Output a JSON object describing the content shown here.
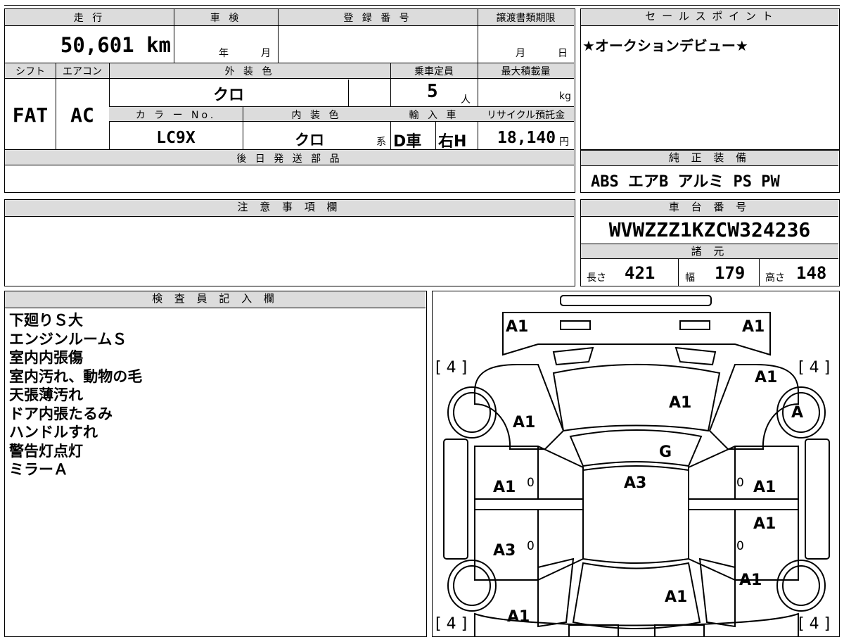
{
  "top_table": {
    "mileage_label": "走 行",
    "mileage_value": "50,601 km",
    "inspection_label": "車 検",
    "inspection_year": "年",
    "inspection_month": "月",
    "registration_label": "登 録 番 号",
    "transfer_label": "譲渡書類期限",
    "transfer_month": "月",
    "transfer_day": "日",
    "shift_label": "シフト",
    "shift_value": "FAT",
    "aircon_label": "エアコン",
    "aircon_value": "AC",
    "exterior_label": "外 装 色",
    "exterior_value": "クロ",
    "capacity_label": "乗車定員",
    "capacity_value": "5",
    "capacity_unit": "人",
    "load_label": "最大積載量",
    "load_unit": "kg",
    "color_no_label": "カ ラ ー No.",
    "color_no_value": "LC9X",
    "interior_label": "内 装 色",
    "interior_value": "クロ",
    "interior_suffix": "系",
    "import_label": "輸 入 車",
    "import_dealer": "D車",
    "import_handle": "右H",
    "recycle_label": "リサイクル預託金",
    "recycle_value": "18,140",
    "recycle_unit": "円",
    "later_parts_label": "後 日 発 送 部 品"
  },
  "sales_point": {
    "label": "セ ー ル ス ポ イ ン ト",
    "text": "★オークションデビュー★"
  },
  "genuine_equipment": {
    "label": "純 正 装 備",
    "text": "ABS エアB アルミ PS PW"
  },
  "notes": {
    "label": "注 意 事 項 欄"
  },
  "chassis": {
    "label": "車 台 番 号",
    "value": "WVWZZZ1KZCW324236"
  },
  "specs": {
    "label": "諸 元",
    "length_label": "長さ",
    "length_value": "421",
    "width_label": "幅",
    "width_value": "179",
    "height_label": "高さ",
    "height_value": "148"
  },
  "inspector": {
    "label": "検 査 員 記 入 欄",
    "remarks": [
      "下廻りＳ大",
      "エンジンルームＳ",
      "室内内張傷",
      "室内汚れ、動物の毛",
      "天張薄汚れ",
      "ドア内張たるみ",
      "ハンドルすれ",
      "警告灯点灯",
      "ミラーＡ"
    ]
  },
  "diagram": {
    "marks": {
      "front_left_corner": "A1",
      "front_right_corner": "A1",
      "tire_fl": "[ 4 ]",
      "tire_fr": "[ 4 ]",
      "tire_rl": "[ 4 ]",
      "tire_rr": "[ 4 ]",
      "front_right_fender": "A1",
      "front_right_wheel": "A",
      "hood": "A1",
      "front_left_fender": "A1",
      "windshield": "G",
      "roof": "A3",
      "front_left_door": "A1",
      "front_left_door_zero": "0",
      "front_right_door_zero": "0",
      "front_right_door": "A1",
      "rear_right_door": "A1",
      "rear_left_door": "A3",
      "rear_left_door_zero": "0",
      "rear_right_door_zero": "0",
      "rear_right_quarter": "A1",
      "trunk": "A1",
      "rear_left_quarter": "A1"
    }
  }
}
